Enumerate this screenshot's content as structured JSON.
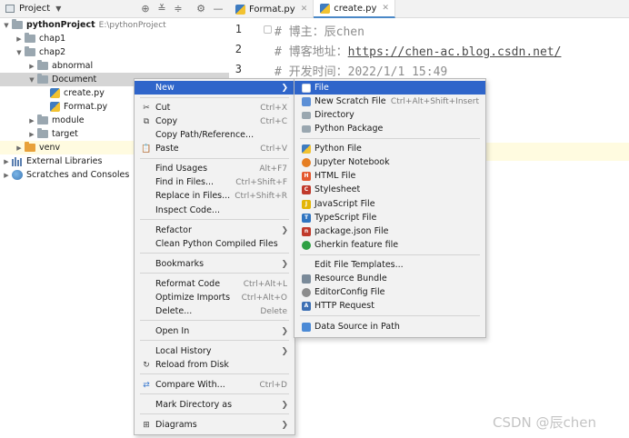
{
  "project_header": {
    "title": "Project"
  },
  "tabs": [
    {
      "label": "Format.py",
      "active": false
    },
    {
      "label": "create.py",
      "active": true
    }
  ],
  "tree": {
    "root_label": "pythonProject",
    "root_path": "E:\\pythonProject",
    "items": [
      {
        "label": "chap1"
      },
      {
        "label": "chap2"
      },
      {
        "label": "abnormal"
      },
      {
        "label": "Document"
      },
      {
        "label": "create.py"
      },
      {
        "label": "Format.py"
      },
      {
        "label": "module"
      },
      {
        "label": "target"
      },
      {
        "label": "venv"
      },
      {
        "label": "External Libraries"
      },
      {
        "label": "Scratches and Consoles"
      }
    ]
  },
  "editor": {
    "line_numbers": [
      "1",
      "2",
      "3"
    ],
    "lines": [
      {
        "prefix": "# 博主：辰chen",
        "link": ""
      },
      {
        "prefix": "# 博客地址：",
        "link": "https://chen-ac.blog.csdn.net/"
      },
      {
        "prefix": "# 开发时间：2022/1/1 15:49",
        "link": ""
      }
    ],
    "watermark": "CSDN @辰chen"
  },
  "context_menu": {
    "items": [
      {
        "label": "New",
        "shortcut": "",
        "submenu": true
      },
      {
        "label": "Cut",
        "shortcut": "Ctrl+X",
        "submenu": false
      },
      {
        "label": "Copy",
        "shortcut": "Ctrl+C",
        "submenu": false
      },
      {
        "label": "Copy Path/Reference...",
        "shortcut": "",
        "submenu": false
      },
      {
        "label": "Paste",
        "shortcut": "Ctrl+V",
        "submenu": false
      },
      {
        "label": "Find Usages",
        "shortcut": "Alt+F7",
        "submenu": false
      },
      {
        "label": "Find in Files...",
        "shortcut": "Ctrl+Shift+F",
        "submenu": false
      },
      {
        "label": "Replace in Files...",
        "shortcut": "Ctrl+Shift+R",
        "submenu": false
      },
      {
        "label": "Inspect Code...",
        "shortcut": "",
        "submenu": false
      },
      {
        "label": "Refactor",
        "shortcut": "",
        "submenu": true
      },
      {
        "label": "Clean Python Compiled Files",
        "shortcut": "",
        "submenu": false
      },
      {
        "label": "Bookmarks",
        "shortcut": "",
        "submenu": true
      },
      {
        "label": "Reformat Code",
        "shortcut": "Ctrl+Alt+L",
        "submenu": false
      },
      {
        "label": "Optimize Imports",
        "shortcut": "Ctrl+Alt+O",
        "submenu": false
      },
      {
        "label": "Delete...",
        "shortcut": "Delete",
        "submenu": false
      },
      {
        "label": "Open In",
        "shortcut": "",
        "submenu": true
      },
      {
        "label": "Local History",
        "shortcut": "",
        "submenu": true
      },
      {
        "label": "Reload from Disk",
        "shortcut": "",
        "submenu": false
      },
      {
        "label": "Compare With...",
        "shortcut": "Ctrl+D",
        "submenu": false
      },
      {
        "label": "Mark Directory as",
        "shortcut": "",
        "submenu": true
      },
      {
        "label": "Diagrams",
        "shortcut": "",
        "submenu": true
      }
    ]
  },
  "new_submenu": {
    "items": [
      {
        "label": "File",
        "shortcut": ""
      },
      {
        "label": "New Scratch File",
        "shortcut": "Ctrl+Alt+Shift+Insert"
      },
      {
        "label": "Directory",
        "shortcut": ""
      },
      {
        "label": "Python Package",
        "shortcut": ""
      },
      {
        "label": "Python File",
        "shortcut": ""
      },
      {
        "label": "Jupyter Notebook",
        "shortcut": ""
      },
      {
        "label": "HTML File",
        "shortcut": ""
      },
      {
        "label": "Stylesheet",
        "shortcut": ""
      },
      {
        "label": "JavaScript File",
        "shortcut": ""
      },
      {
        "label": "TypeScript File",
        "shortcut": ""
      },
      {
        "label": "package.json File",
        "shortcut": ""
      },
      {
        "label": "Gherkin feature file",
        "shortcut": ""
      },
      {
        "label": "Edit File Templates...",
        "shortcut": ""
      },
      {
        "label": "Resource Bundle",
        "shortcut": ""
      },
      {
        "label": "EditorConfig File",
        "shortcut": ""
      },
      {
        "label": "HTTP Request",
        "shortcut": ""
      },
      {
        "label": "Data Source in Path",
        "shortcut": ""
      }
    ]
  },
  "colors": {
    "menu_highlight": "#2f65ca",
    "selection": "#d5d5d5",
    "venv_highlight": "#fffbe0"
  }
}
